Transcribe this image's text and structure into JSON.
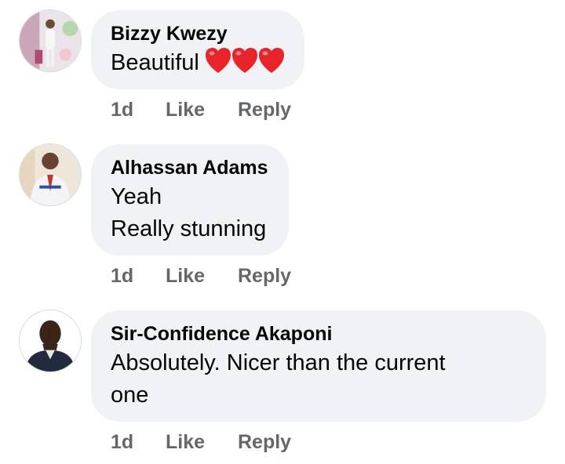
{
  "comments": [
    {
      "author": "Bizzy Kwezy",
      "text_lines": [
        "Beautiful"
      ],
      "reaction_icons": [
        "heart-emoji",
        "heart-emoji",
        "heart-emoji"
      ],
      "time": "1d",
      "like_label": "Like",
      "reply_label": "Reply"
    },
    {
      "author": "Alhassan Adams",
      "text_lines": [
        "Yeah",
        "Really stunning"
      ],
      "time": "1d",
      "like_label": "Like",
      "reply_label": "Reply"
    },
    {
      "author": "Sir-Confidence Akaponi",
      "text_lines": [
        "Absolutely. Nicer than the current",
        "one"
      ],
      "time": "1d",
      "like_label": "Like",
      "reply_label": "Reply"
    }
  ],
  "colors": {
    "bubble_bg": "#f0f2f5",
    "meta_text": "#65676b",
    "heart": "#e8232a"
  }
}
